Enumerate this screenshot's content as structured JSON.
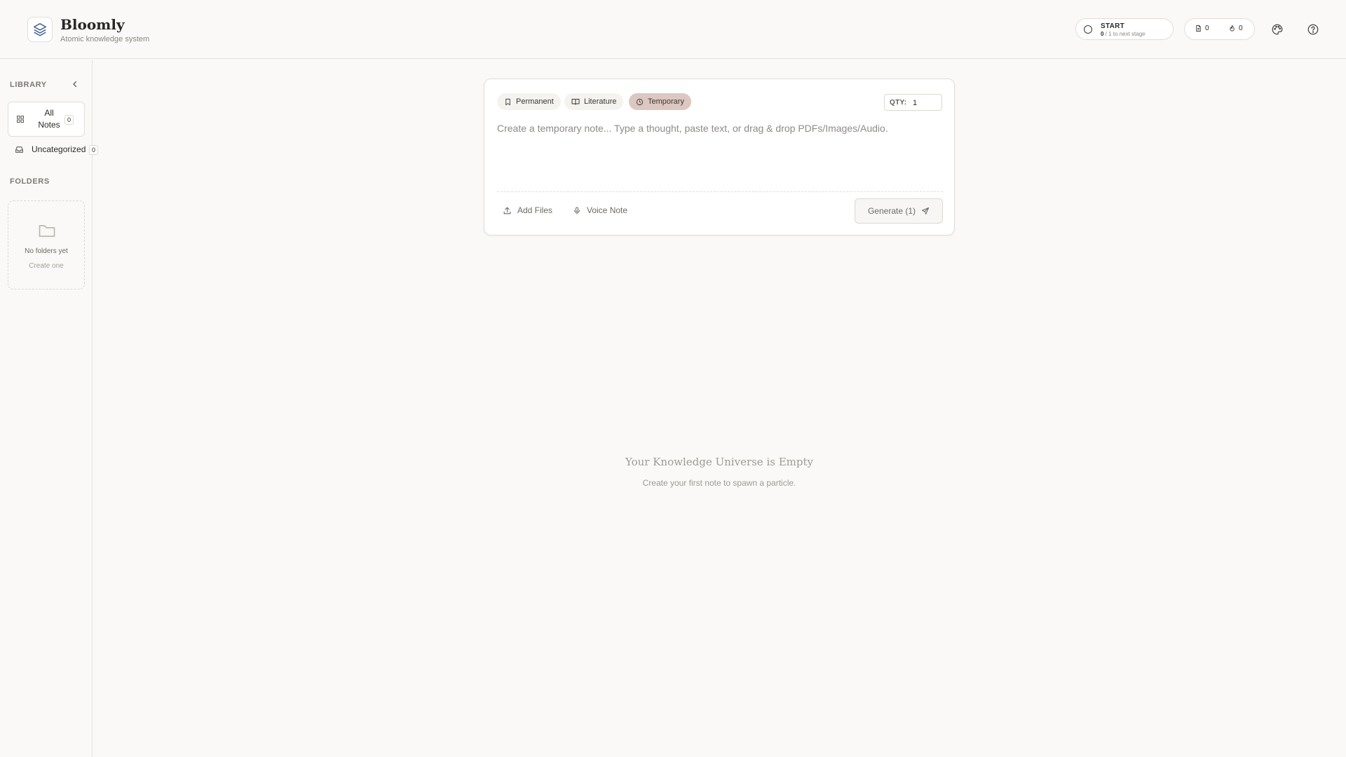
{
  "app": {
    "title": "Bloomly",
    "subtitle": "Atomic knowledge system"
  },
  "header": {
    "stage": {
      "name": "START",
      "progress_current": "0",
      "progress_text": " / 1 to next stage"
    },
    "counts": {
      "notes": "0",
      "streak": "0"
    },
    "icons": [
      "layers-icon",
      "circle-icon",
      "file-icon",
      "flame-icon",
      "palette-icon",
      "help-circle-icon"
    ]
  },
  "sidebar": {
    "library_heading": "LIBRARY",
    "all_notes": {
      "label": "All Notes",
      "count": "0"
    },
    "uncategorized": {
      "label": "Uncategorized",
      "count": "0"
    },
    "folders_heading": "FOLDERS",
    "folders_empty": {
      "title": "No folders yet",
      "action": "Create one"
    }
  },
  "composer": {
    "tabs": [
      {
        "label": "Permanent",
        "icon": "bookmark-icon",
        "active": false
      },
      {
        "label": "Literature",
        "icon": "book-open-icon",
        "active": false
      },
      {
        "label": "Temporary",
        "icon": "clock-icon",
        "active": true
      }
    ],
    "qty_label": "QTY:",
    "qty_value": "1",
    "placeholder": "Create a temporary note... Type a thought, paste text, or drag & drop PDFs/Images/Audio.",
    "add_files_label": "Add Files",
    "voice_note_label": "Voice Note",
    "generate_label": "Generate (1)"
  },
  "empty_state": {
    "title": "Your Knowledge Universe is Empty",
    "subtitle": "Create your first note to spawn a particle."
  },
  "colors": {
    "background": "#faf9f7",
    "active_tab": "#dcc8c1",
    "border": "#e2ded8",
    "muted_text": "#9e9a94"
  }
}
